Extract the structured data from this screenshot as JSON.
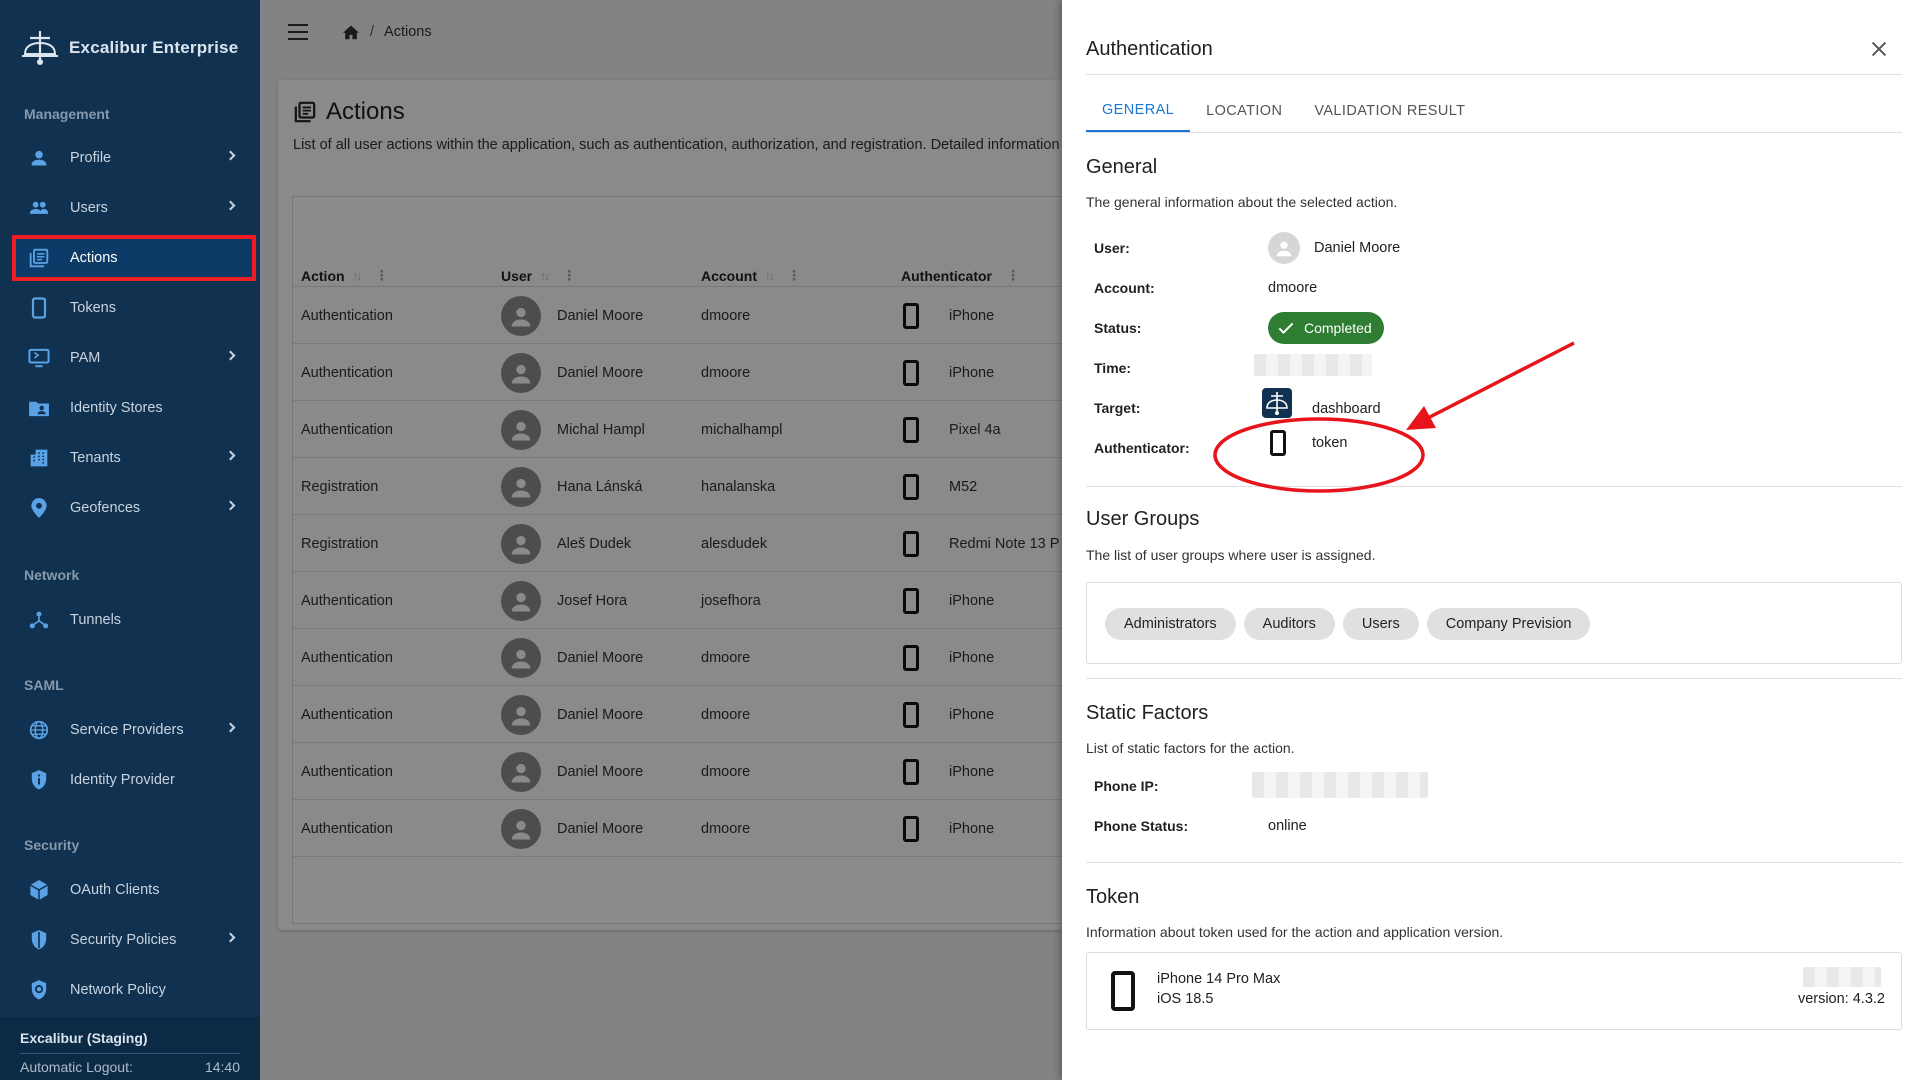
{
  "sidebar": {
    "brand": "Excalibur Enterprise",
    "sections": {
      "management": "Management",
      "network": "Network",
      "saml": "SAML",
      "security": "Security"
    },
    "items": [
      {
        "label": "Profile"
      },
      {
        "label": "Users"
      },
      {
        "label": "Actions"
      },
      {
        "label": "Tokens"
      },
      {
        "label": "PAM"
      },
      {
        "label": "Identity Stores"
      },
      {
        "label": "Tenants"
      },
      {
        "label": "Geofences"
      },
      {
        "label": "Tunnels"
      },
      {
        "label": "Service Providers"
      },
      {
        "label": "Identity Provider"
      },
      {
        "label": "OAuth Clients"
      },
      {
        "label": "Security Policies"
      },
      {
        "label": "Network Policy"
      }
    ],
    "footer": {
      "environment": "Excalibur (Staging)",
      "logout_label": "Automatic Logout:",
      "logout_time": "14:40"
    }
  },
  "breadcrumb": {
    "separator": "/",
    "current": "Actions"
  },
  "page": {
    "title": "Actions",
    "description": "List of all user actions within the application, such as authentication, authorization, and registration. Detailed information"
  },
  "table": {
    "columns": [
      "Action",
      "User",
      "Account",
      "Authenticator"
    ],
    "rows": [
      {
        "action": "Authentication",
        "user": "Daniel Moore",
        "account": "dmoore",
        "device": "iPhone"
      },
      {
        "action": "Authentication",
        "user": "Daniel Moore",
        "account": "dmoore",
        "device": "iPhone"
      },
      {
        "action": "Authentication",
        "user": "Michal Hampl",
        "account": "michalhampl",
        "device": "Pixel 4a"
      },
      {
        "action": "Registration",
        "user": "Hana Lánská",
        "account": "hanalanska",
        "device": "M52"
      },
      {
        "action": "Registration",
        "user": "Aleš Dudek",
        "account": "alesdudek",
        "device": "Redmi Note 13 P"
      },
      {
        "action": "Authentication",
        "user": "Josef Hora",
        "account": "josefhora",
        "device": "iPhone"
      },
      {
        "action": "Authentication",
        "user": "Daniel Moore",
        "account": "dmoore",
        "device": "iPhone"
      },
      {
        "action": "Authentication",
        "user": "Daniel Moore",
        "account": "dmoore",
        "device": "iPhone"
      },
      {
        "action": "Authentication",
        "user": "Daniel Moore",
        "account": "dmoore",
        "device": "iPhone"
      },
      {
        "action": "Authentication",
        "user": "Daniel Moore",
        "account": "dmoore",
        "device": "iPhone"
      }
    ]
  },
  "drawer": {
    "title": "Authentication",
    "tabs": [
      "GENERAL",
      "LOCATION",
      "VALIDATION RESULT"
    ],
    "general": {
      "heading": "General",
      "description": "The general information about the selected action.",
      "labels": {
        "user": "User:",
        "account": "Account:",
        "status": "Status:",
        "time": "Time:",
        "target": "Target:",
        "authenticator": "Authenticator:"
      },
      "user": "Daniel Moore",
      "account": "dmoore",
      "status": "Completed",
      "target": "dashboard",
      "authenticator": "token"
    },
    "groups": {
      "heading": "User Groups",
      "description": "The list of user groups where user is assigned.",
      "items": [
        "Administrators",
        "Auditors",
        "Users",
        "Company Prevision"
      ]
    },
    "static_factors": {
      "heading": "Static Factors",
      "description": "List of static factors for the action.",
      "labels": {
        "phone_ip": "Phone IP:",
        "phone_status": "Phone Status:"
      },
      "phone_status": "online"
    },
    "token": {
      "heading": "Token",
      "description": "Information about token used for the action and application version.",
      "device": "iPhone 14 Pro Max",
      "os": "iOS 18.5",
      "version": "version: 4.3.2"
    }
  },
  "colors": {
    "sidebar": "#10314f",
    "accent": "#1976d2",
    "status_completed": "#2e7d32",
    "annotation": "#e8141c"
  }
}
